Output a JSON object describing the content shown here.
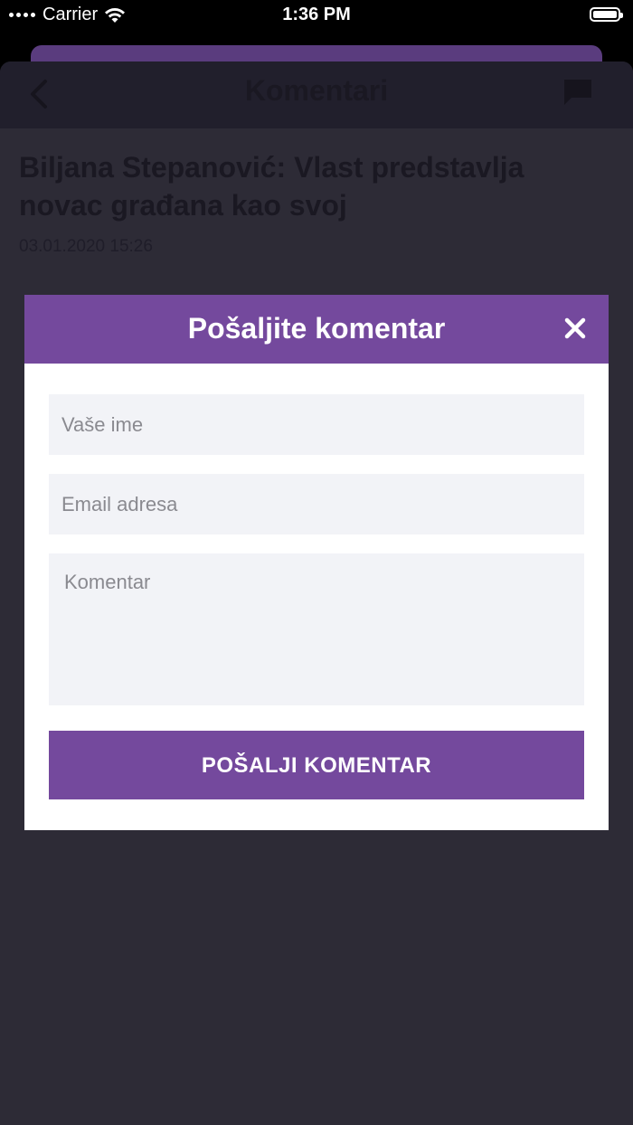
{
  "status_bar": {
    "carrier": "Carrier",
    "time": "1:36 PM"
  },
  "nav": {
    "title": "Komentari"
  },
  "article": {
    "title": "Biljana Stepanović: Vlast predstavlja novac građana kao svoj",
    "date": "03.01.2020 15:26"
  },
  "modal": {
    "title": "Pošaljite komentar",
    "name_placeholder": "Vaše ime",
    "email_placeholder": "Email adresa",
    "comment_placeholder": "Komentar",
    "submit_label": "POŠALJI KOMENTAR"
  },
  "colors": {
    "accent": "#74499d",
    "sheet_bg": "#2d2b36",
    "field_bg": "#f2f3f7"
  }
}
